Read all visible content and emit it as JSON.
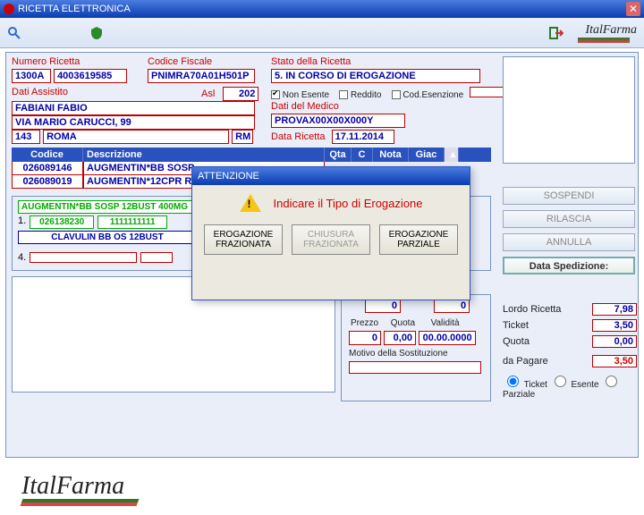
{
  "window": {
    "title": "RICETTA ELETTRONICA"
  },
  "toolbar": {
    "brand": "ItalFarma"
  },
  "fields": {
    "numero_ricetta_label": "Numero Ricetta",
    "numero_ricetta_a": "1300A",
    "numero_ricetta_b": "4003619585",
    "codice_fiscale_label": "Codice Fiscale",
    "codice_fiscale": "PNIMRA70A01H501P",
    "stato_label": "Stato della Ricetta",
    "stato_value": "5. IN CORSO DI EROGAZIONE",
    "dati_assistito_label": "Dati Assistito",
    "asl_label": "Asl",
    "asl_value": "202",
    "assistito_nome": "FABIANI FABIO",
    "assistito_indirizzo": "VIA MARIO CARUCCI, 99",
    "assistito_cap": "143",
    "assistito_citta": "ROMA",
    "assistito_prov": "RM",
    "non_esente_label": "Non Esente",
    "reddito_label": "Reddito",
    "cod_esenzione_label": "Cod.Esenzione",
    "cod_esenzione_value": "",
    "dati_medico_label": "Dati del Medico",
    "medico_value": "PROVAX00X00X000Y",
    "data_ricetta_label": "Data Ricetta",
    "data_ricetta_value": "17.11.2014"
  },
  "grid": {
    "head": {
      "codice": "Codice",
      "descrizione": "Descrizione",
      "qta": "Qta",
      "c": "C",
      "nota": "Nota",
      "giac": "Giac"
    },
    "rows": [
      {
        "codice": "026089146",
        "descrizione": "AUGMENTIN*BB SOSP"
      },
      {
        "codice": "026089019",
        "descrizione": "AUGMENTIN*12CPR RI"
      }
    ]
  },
  "sub": {
    "title": "AUGMENTIN*BB SOSP 12BUST 400MG",
    "row1": [
      "1.",
      "026138230",
      "1111111111"
    ],
    "row2": "CLAVULIN BB OS 12BUST",
    "row3": "4."
  },
  "subinfo": {
    "val_top": "0",
    "val_top2": "0",
    "prezzo_label": "Prezzo",
    "quota_label": "Quota",
    "validita_label": "Validità",
    "prezzo": "0",
    "quota": "0,00",
    "validita": "00.00.0000",
    "motivo_label": "Motivo della Sostituzione",
    "motivo": ""
  },
  "right": {
    "sospendi": "SOSPENDI",
    "rilascia": "RILASCIA",
    "annulla": "ANNULLA",
    "data_spedizione": "Data Spedizione:"
  },
  "totals": {
    "lordo_label": "Lordo Ricetta",
    "lordo": "7,98",
    "ticket_label": "Ticket",
    "ticket": "3,50",
    "quota_label": "Quota",
    "quota": "0,00",
    "pagare_label": "da Pagare",
    "pagare": "3,50",
    "opt_ticket": "Ticket",
    "opt_esente": "Esente",
    "opt_parziale": "Parziale"
  },
  "modal": {
    "title": "ATTENZIONE",
    "message": "Indicare il Tipo di Erogazione",
    "btn1a": "EROGAZIONE",
    "btn1b": "FRAZIONATA",
    "btn2a": "CHIUSURA",
    "btn2b": "FRAZIONATA",
    "btn3a": "EROGAZIONE",
    "btn3b": "PARZIALE"
  },
  "footer": {
    "brand": "ItalFarma"
  }
}
